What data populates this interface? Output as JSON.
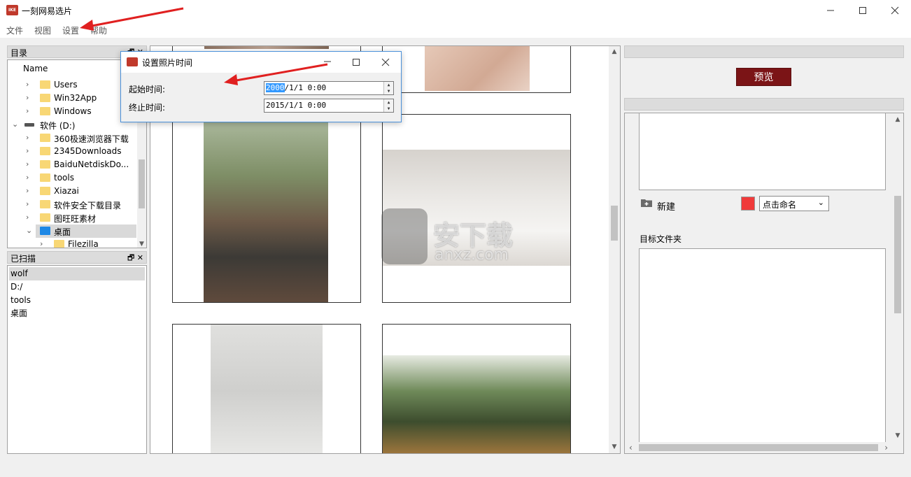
{
  "window": {
    "title": "一刻网易选片",
    "logo_text": "IKE"
  },
  "menu": [
    "文件",
    "视图",
    "设置",
    "帮助"
  ],
  "directory_panel": {
    "title": "目录",
    "column_header": "Name",
    "items": [
      {
        "label": "Users",
        "type": "folder",
        "level": 1,
        "expanded": false
      },
      {
        "label": "Win32App",
        "type": "folder",
        "level": 1,
        "expanded": false
      },
      {
        "label": "Windows",
        "type": "folder",
        "level": 1,
        "expanded": false
      },
      {
        "label": "软件 (D:)",
        "type": "drive",
        "level": 0,
        "expanded": true
      },
      {
        "label": "360极速浏览器下载",
        "type": "folder",
        "level": 1,
        "expanded": false
      },
      {
        "label": "2345Downloads",
        "type": "folder",
        "level": 1,
        "expanded": false
      },
      {
        "label": "BaiduNetdiskDo...",
        "type": "folder",
        "level": 1,
        "expanded": false
      },
      {
        "label": "tools",
        "type": "folder",
        "level": 1,
        "expanded": false
      },
      {
        "label": "Xiazai",
        "type": "folder",
        "level": 1,
        "expanded": false
      },
      {
        "label": "软件安全下载目录",
        "type": "folder",
        "level": 1,
        "expanded": false
      },
      {
        "label": "图旺旺素材",
        "type": "folder",
        "level": 1,
        "expanded": false
      },
      {
        "label": "桌面",
        "type": "folder-blue",
        "level": 1,
        "expanded": true,
        "selected": true
      },
      {
        "label": "Filezilla",
        "type": "folder",
        "level": 2,
        "expanded": false
      }
    ]
  },
  "scanned_panel": {
    "title": "已扫描",
    "items": [
      {
        "label": "wolf",
        "selected": true
      },
      {
        "label": "D:/",
        "selected": false
      },
      {
        "label": "tools",
        "selected": false
      },
      {
        "label": "桌面",
        "selected": false
      }
    ]
  },
  "right_panel": {
    "preview_label": "预览",
    "new_label": "新建",
    "name_dropdown": "点击命名",
    "target_folder_label": "目标文件夹",
    "color_swatch": "#f03a3a"
  },
  "dialog": {
    "title": "设置照片时间",
    "start_label": "起始时间:",
    "end_label": "终止时间:",
    "start_value_selected": "2000",
    "start_value_rest": "/1/1 0:00",
    "end_value": "2015/1/1 0:00"
  },
  "watermark": {
    "main": "安下载",
    "sub": "anxz.com"
  },
  "colors": {
    "accent": "#7b1416",
    "annotation": "#e02020",
    "selection": "#3399ff"
  }
}
